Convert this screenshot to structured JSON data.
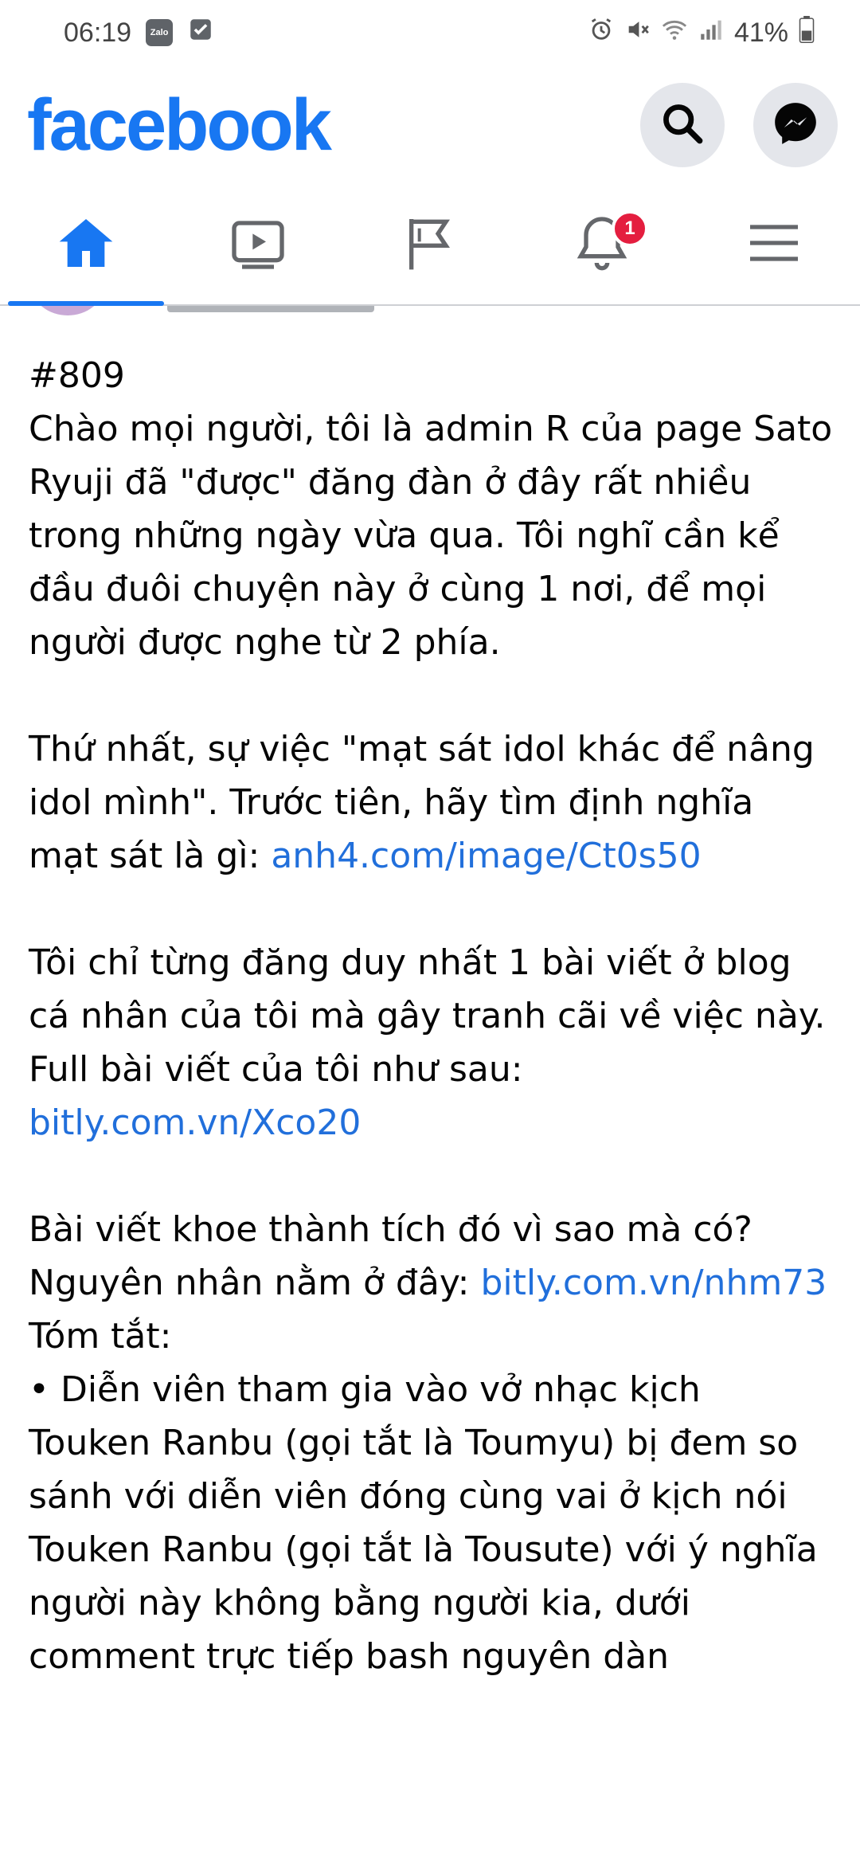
{
  "status_bar": {
    "time": "06:19",
    "app_badge": "Zalo",
    "battery": "41%"
  },
  "header": {
    "logo": "facebook",
    "search_icon": "search-icon",
    "messenger_icon": "messenger-icon"
  },
  "tabs": [
    {
      "name": "home",
      "icon": "home-icon",
      "active": true
    },
    {
      "name": "watch",
      "icon": "video-icon",
      "active": false
    },
    {
      "name": "pages",
      "icon": "flag-icon",
      "active": false
    },
    {
      "name": "notifications",
      "icon": "bell-icon",
      "active": false,
      "badge": "1"
    },
    {
      "name": "menu",
      "icon": "menu-icon",
      "active": false
    }
  ],
  "colors": {
    "brand": "#1877f2",
    "link": "#216fdb",
    "badge": "#e41e3f"
  },
  "post": {
    "number": "#809",
    "para1": "Chào mọi người, tôi là admin R của page Sato Ryuji đã \"được\" đăng đàn ở đây rất nhiều trong những ngày vừa qua. Tôi nghĩ cần kể đầu đuôi chuyện này ở cùng 1 nơi, để mọi người được nghe từ 2 phía.",
    "para2_text": "Thứ nhất, sự việc \"mạt sát idol khác để nâng idol mình\". Trước tiên, hãy tìm định nghĩa mạt sát là gì: ",
    "para2_link": "anh4.com/image/Ct0s50",
    "para3": "Tôi chỉ từng đăng duy nhất 1 bài viết ở blog cá nhân của tôi mà gây tranh cãi về việc này.",
    "para4_text": "Full bài viết của tôi như sau: ",
    "para4_link": "bitly.com.vn/Xco20",
    "para5": "Bài viết khoe thành tích đó vì sao mà có?",
    "para6_text": "Nguyên nhân nằm ở đây: ",
    "para6_link": "bitly.com.vn/nhm73",
    "para7": "Tóm tắt:",
    "para8": "• Diễn viên tham gia vào vở nhạc kịch Touken Ranbu (gọi tắt là Toumyu) bị đem so sánh với diễn viên đóng cùng vai ở kịch nói Touken Ranbu (gọi tắt là Tousute) với ý nghĩa người này không bằng người kia, dưới comment trực tiếp bash nguyên dàn"
  }
}
